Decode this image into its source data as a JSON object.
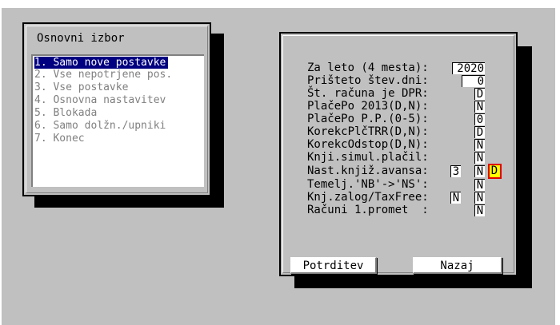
{
  "menu": {
    "title": "Osnovni izbor",
    "items": [
      "1. Samo nove postavke",
      "2. Vse nepotrjene pos.",
      "3. Vse postavke",
      "4. Osnovna nastavitev",
      "5. Blokada",
      "6. Samo dolžn./upniki",
      "7. Konec"
    ],
    "selected_index": 0
  },
  "settings": {
    "rows": [
      {
        "label": "Za leto (4 mesta):",
        "value": "2020"
      },
      {
        "label": "Prišteto štev.dni:",
        "value": "0"
      },
      {
        "label": "Št. računa je DPR:",
        "value": "D"
      },
      {
        "label": "PlačePo 2013(D,N):",
        "value": "N"
      },
      {
        "label": "PlačePo P.P.(0-5):",
        "value": "0"
      },
      {
        "label": "KorekcPlčTRR(D,N):",
        "value": "D"
      },
      {
        "label": "KorekcOdstop(D,N):",
        "value": "N"
      },
      {
        "label": "Knji.simul.plačil:",
        "value": "N"
      },
      {
        "label": "Nast.knjiž.avansa:",
        "value": "3",
        "value2": "N",
        "value3": "D"
      },
      {
        "label": "Temelj.'NB'->'NS':",
        "value": "N"
      },
      {
        "label": "Knj.zalog/TaxFree:",
        "value": "N",
        "value2": "N"
      },
      {
        "label": "Računi 1.promet  :",
        "value": "N"
      }
    ],
    "confirm_label": "Potrditev",
    "back_label": "Nazaj"
  },
  "colors": {
    "background": "#c0c0c0",
    "selection": "#000080",
    "highlight_fill": "#ffff00",
    "highlight_border": "#e00000"
  }
}
